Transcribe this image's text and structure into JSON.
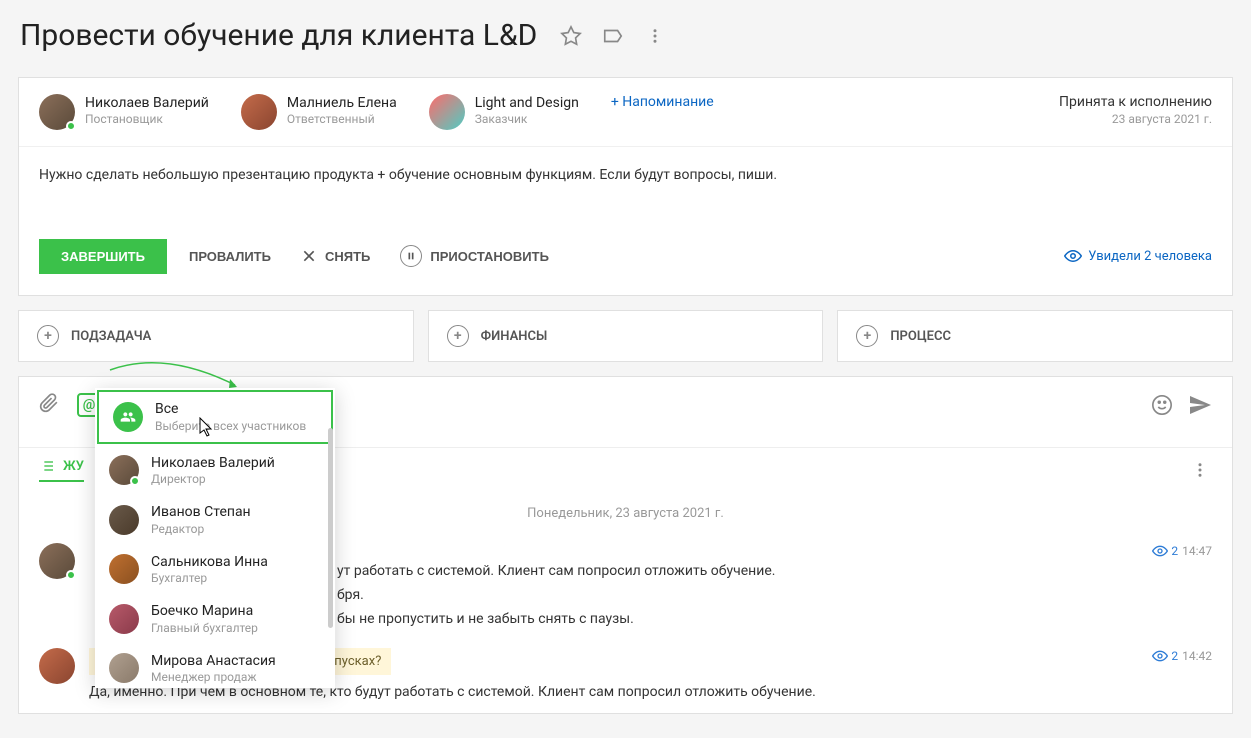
{
  "title": "Провести обучение для клиента L&D",
  "people": {
    "creator": {
      "name": "Николаев Валерий",
      "role": "Постановщик"
    },
    "responsible": {
      "name": "Малниель Елена",
      "role": "Ответственный"
    },
    "client": {
      "name": "Light and Design",
      "role": "Заказчик"
    }
  },
  "reminder": "+ Напоминание",
  "status": {
    "label": "Принята к исполнению",
    "date": "23 августа 2021 г."
  },
  "description": "Нужно сделать небольшую презентацию продукта + обучение основным функциям. Если будут вопросы, пиши.",
  "actions": {
    "complete": "Завершить",
    "fail": "Провалить",
    "cancel": "Снять",
    "pause": "Приостановить",
    "seen": "Увидели 2 человека"
  },
  "subactions": {
    "subtask": "Подзадача",
    "finance": "Финансы",
    "process": "Процесс"
  },
  "tabs": {
    "journal": "Жу"
  },
  "dateLabel": "Понедельник, 23 августа 2021 г.",
  "mentionSymbol": "@",
  "messages": [
    {
      "author": "",
      "fragment1": "ут работать с системой. Клиент сам попросил отложить обучение.",
      "fragment2": "бря.",
      "fragment3": "бы не пропустить и не забыть снять с паузы.",
      "views": "2",
      "time": "14:47"
    },
    {
      "reply": "Ты имеешь ввиду, что сотрудники в отпусках?",
      "text": "Да, именно. При чём в основном те, кто будут работать с системой. Клиент сам попросил отложить обучение.",
      "views": "2",
      "time": "14:42"
    }
  ],
  "mentionDropdown": [
    {
      "name": "Все",
      "role": "Выберите всех участников",
      "active": true,
      "all": true
    },
    {
      "name": "Николаев Валерий",
      "role": "Директор",
      "online": true
    },
    {
      "name": "Иванов Степан",
      "role": "Редактор"
    },
    {
      "name": "Сальникова Инна",
      "role": "Бухгалтер"
    },
    {
      "name": "Боечко Марина",
      "role": "Главный бухгалтер"
    },
    {
      "name": "Мирова Анастасия",
      "role": "Менеджер продаж"
    }
  ]
}
